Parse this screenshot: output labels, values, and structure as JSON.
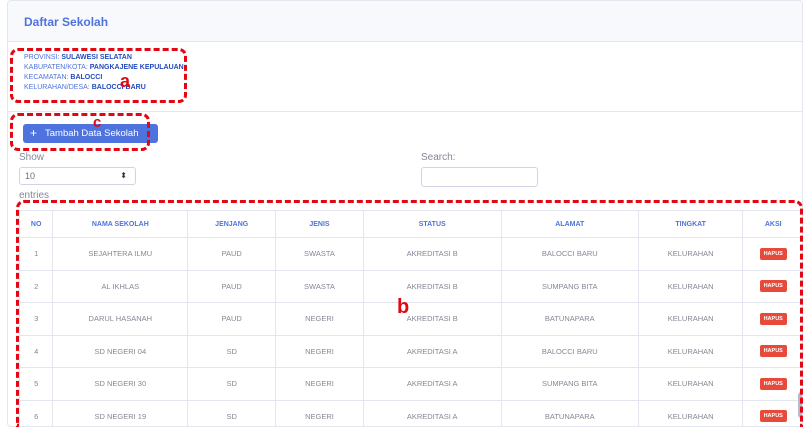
{
  "header": {
    "title": "Daftar Sekolah"
  },
  "location": [
    {
      "label": "PROVINSI:",
      "value": "SULAWESI SELATAN"
    },
    {
      "label": "KABUPATEN/KOTA:",
      "value": "PANGKAJENE KEPULAUAN"
    },
    {
      "label": "KECAMATAN:",
      "value": "BALOCCI"
    },
    {
      "label": "KELURAHAN/DESA:",
      "value": "BALOCCI BARU"
    }
  ],
  "toolbar": {
    "add_icon": "plus-icon",
    "add_label": "Tambah Data Sekolah"
  },
  "length": {
    "show_label": "Show",
    "selected": "10",
    "entries_label": "entries"
  },
  "search": {
    "label": "Search:",
    "value": ""
  },
  "table": {
    "columns": [
      "NO",
      "NAMA SEKOLAH",
      "JENJANG",
      "JENIS",
      "STATUS",
      "ALAMAT",
      "TINGKAT",
      "AKSI"
    ],
    "rows": [
      [
        "1",
        "SEJAHTERA ILMU",
        "PAUD",
        "SWASTA",
        "AKREDITASI B",
        "BALOCCI BARU",
        "KELURAHAN",
        "HAPUS"
      ],
      [
        "2",
        "AL IKHLAS",
        "PAUD",
        "SWASTA",
        "AKREDITASI B",
        "SUMPANG BITA",
        "KELURAHAN",
        "HAPUS"
      ],
      [
        "3",
        "DARUL HASANAH",
        "PAUD",
        "NEGERI",
        "AKREDITASI B",
        "BATUNAPARA",
        "KELURAHAN",
        "HAPUS"
      ],
      [
        "4",
        "SD NEGERI 04",
        "SD",
        "NEGERI",
        "AKREDITASI A",
        "BALOCCI BARU",
        "KELURAHAN",
        "HAPUS"
      ],
      [
        "5",
        "SD NEGERI 30",
        "SD",
        "NEGERI",
        "AKREDITASI A",
        "SUMPANG BITA",
        "KELURAHAN",
        "HAPUS"
      ],
      [
        "6",
        "SD NEGERI 19",
        "SD",
        "NEGERI",
        "AKREDITASI A",
        "BATUNAPARA",
        "KELURAHAN",
        "HAPUS"
      ]
    ]
  },
  "annotations": {
    "a": "a",
    "b": "b",
    "c": "c"
  },
  "colors": {
    "primary": "#4e73df",
    "danger": "#e74a3b",
    "annotation": "#e30613"
  }
}
